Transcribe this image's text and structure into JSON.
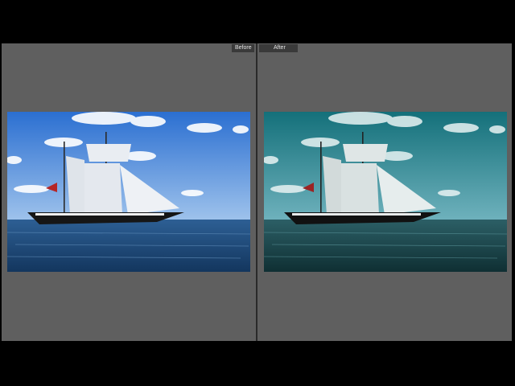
{
  "view": {
    "mode": "before-after-compare",
    "before_label": "Before",
    "after_label": "After"
  },
  "photos": {
    "before": {
      "name": "original-photo",
      "sky_top": "#2b6fd1",
      "sky_bottom": "#9fc3ec",
      "water_top": "#2d5f94",
      "water_bottom": "#13365e"
    },
    "after": {
      "name": "edited-photo",
      "sky_top": "#14707a",
      "sky_bottom": "#6fb2bd",
      "water_top": "#2c5f66",
      "water_bottom": "#0f2f33"
    }
  },
  "colors": {
    "background": "#000000",
    "panel": "#5f5f5f",
    "label_bg": "#3a3a3a",
    "label_text": "#e6e6e6"
  }
}
